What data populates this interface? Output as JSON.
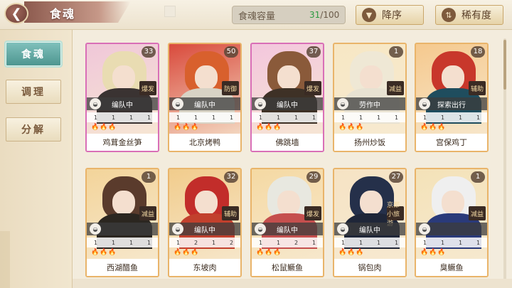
{
  "header": {
    "title": "食魂",
    "back_icon": "back-arrow-icon"
  },
  "capacity": {
    "label": "食魂容量",
    "current": "31",
    "max": "/100"
  },
  "sort": {
    "order_label": "降序",
    "order_icon": "descending-icon",
    "rarity_label": "稀有度",
    "rarity_icon": "sort-icon"
  },
  "sidebar": {
    "tabs": [
      {
        "label": "食魂"
      },
      {
        "label": "调理"
      },
      {
        "label": "分解"
      }
    ]
  },
  "cards": [
    {
      "name": "鸡茸金丝笋",
      "level": "33",
      "status": "编队中",
      "role": "爆发",
      "stats": [
        "1",
        "1",
        "1",
        "1"
      ],
      "hair": "#e9dcb2",
      "body": "#3a3332",
      "bg": "#f0c7d9",
      "frame": "#d96fb7"
    },
    {
      "name": "北京烤鸭",
      "level": "50",
      "status": "编队中",
      "role": "防御",
      "stats": [
        "1",
        "1",
        "1",
        "1"
      ],
      "hair": "#d8602d",
      "body": "#d8d3c5",
      "bg": "#d94a3c",
      "frame": "#e9b46a"
    },
    {
      "name": "佛跳墙",
      "level": "37",
      "status": "编队中",
      "role": "爆发",
      "stats": [
        "1",
        "1",
        "1",
        "1"
      ],
      "hair": "#8a5a3a",
      "body": "#3e3126",
      "bg": "#f3c6dd",
      "frame": "#d96fb7"
    },
    {
      "name": "扬州炒饭",
      "level": "1",
      "status": "劳作中",
      "role": "减益",
      "stats": [
        "1",
        "1",
        "1",
        "1"
      ],
      "hair": "#efe8d5",
      "body": "#e8e2d2",
      "bg": "#f7e7c4",
      "frame": "#e9b46a"
    },
    {
      "name": "宫保鸡丁",
      "level": "18",
      "status": "探索出行",
      "role": "辅助",
      "stats": [
        "1",
        "1",
        "1",
        "1"
      ],
      "hair": "#c8372b",
      "body": "#1f4d5e",
      "bg": "#f5c98e",
      "frame": "#e9b46a"
    },
    {
      "name": "西湖醋鱼",
      "level": "1",
      "status": "",
      "role": "减益",
      "stats": [
        "1",
        "1",
        "1",
        "1"
      ],
      "hair": "#5a3b2c",
      "body": "#2b2620",
      "bg": "#f3d49a",
      "frame": "#e9b46a"
    },
    {
      "name": "东坡肉",
      "level": "32",
      "status": "编队中",
      "role": "辅助",
      "stats": [
        "1",
        "2",
        "1",
        "2"
      ],
      "hair": "#c22d2a",
      "body": "#c2402d",
      "bg": "#f1cc8c",
      "frame": "#e9b46a"
    },
    {
      "name": "松鼠鳜鱼",
      "level": "29",
      "status": "编队中",
      "role": "爆发",
      "stats": [
        "1",
        "1",
        "2",
        "1"
      ],
      "hair": "#e8e8e0",
      "body": "#c54f4e",
      "bg": "#f5d9a3",
      "frame": "#e9b46a"
    },
    {
      "name": "锅包肉",
      "level": "27",
      "status": "编队中",
      "role": "京都小旅游",
      "stats": [
        "1",
        "1",
        "1",
        "1"
      ],
      "hair": "#25304a",
      "body": "#1f2638",
      "bg": "#f6e3c4",
      "frame": "#e9b46a"
    },
    {
      "name": "臭鳜鱼",
      "level": "1",
      "status": "",
      "role": "减益",
      "stats": [
        "1",
        "1",
        "1",
        "1"
      ],
      "hair": "#efefef",
      "body": "#2a3a7a",
      "bg": "#f4e2b8",
      "frame": "#e9b46a"
    }
  ]
}
